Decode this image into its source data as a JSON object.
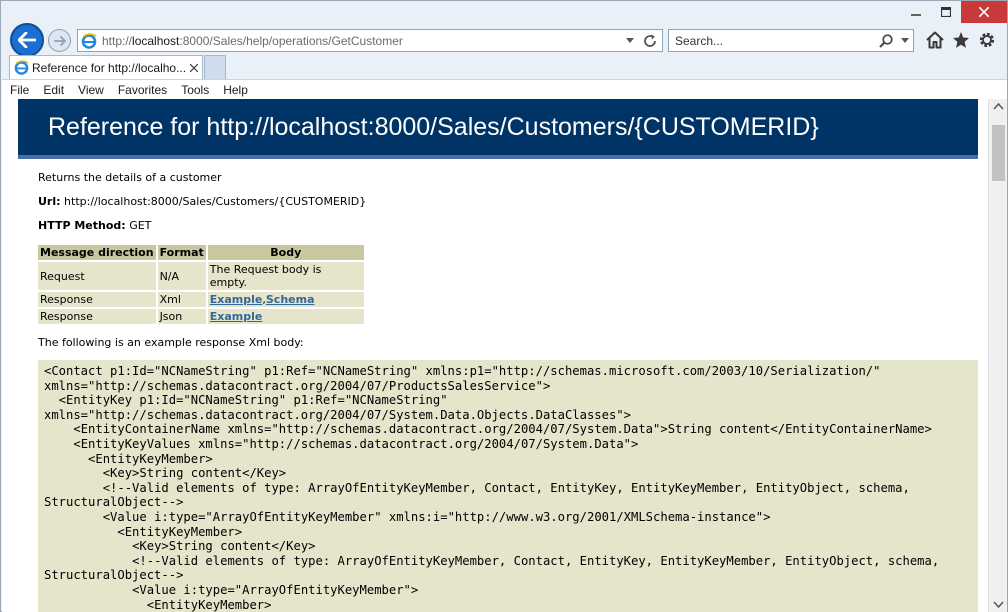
{
  "browser": {
    "address_url_prefix": "http://",
    "address_url_host": "localhost",
    "address_url_rest": ":8000/Sales/help/operations/GetCustomer",
    "search_placeholder": "Search...",
    "tab_label": "Reference for http://localho..."
  },
  "menu": {
    "file": "File",
    "edit": "Edit",
    "view": "View",
    "favorites": "Favorites",
    "tools": "Tools",
    "help": "Help"
  },
  "page": {
    "heading": "Reference for http://localhost:8000/Sales/Customers/{CUSTOMERID}",
    "description": "Returns the details of a customer",
    "url_label": "Url:",
    "url_value": "http://localhost:8000/Sales/Customers/{CUSTOMERID}",
    "method_label": "HTTP Method:",
    "method_value": "GET",
    "table": {
      "headers": [
        "Message direction",
        "Format",
        "Body"
      ],
      "rows": [
        {
          "direction": "Request",
          "format": "N/A",
          "body": "The Request body is empty."
        },
        {
          "direction": "Response",
          "format": "Xml",
          "link1": "Example",
          "sep": ",",
          "link2": "Schema"
        },
        {
          "direction": "Response",
          "format": "Json",
          "link1": "Example"
        }
      ]
    },
    "example_intro": "The following is an example response Xml body:",
    "xml_body": "<Contact p1:Id=\"NCNameString\" p1:Ref=\"NCNameString\" xmlns:p1=\"http://schemas.microsoft.com/2003/10/Serialization/\" xmlns=\"http://schemas.datacontract.org/2004/07/ProductsSalesService\">\n  <EntityKey p1:Id=\"NCNameString\" p1:Ref=\"NCNameString\" xmlns=\"http://schemas.datacontract.org/2004/07/System.Data.Objects.DataClasses\">\n    <EntityContainerName xmlns=\"http://schemas.datacontract.org/2004/07/System.Data\">String content</EntityContainerName>\n    <EntityKeyValues xmlns=\"http://schemas.datacontract.org/2004/07/System.Data\">\n      <EntityKeyMember>\n        <Key>String content</Key>\n        <!--Valid elements of type: ArrayOfEntityKeyMember, Contact, EntityKey, EntityKeyMember, EntityObject, schema, StructuralObject-->\n        <Value i:type=\"ArrayOfEntityKeyMember\" xmlns:i=\"http://www.w3.org/2001/XMLSchema-instance\">\n          <EntityKeyMember>\n            <Key>String content</Key>\n            <!--Valid elements of type: ArrayOfEntityKeyMember, Contact, EntityKey, EntityKeyMember, EntityObject, schema, StructuralObject-->\n            <Value i:type=\"ArrayOfEntityKeyMember\">\n              <EntityKeyMember>"
  },
  "colors": {
    "banner_bg": "#003366",
    "table_header_bg": "#c8c8a0",
    "table_cell_bg": "#e5e5cc",
    "link": "#336699",
    "close_button": "#c7393b",
    "back_button": "#1b6fd1"
  },
  "icons": [
    "minimize-icon",
    "maximize-icon",
    "close-icon",
    "back-arrow-icon",
    "forward-arrow-icon",
    "ie-logo-icon",
    "dropdown-icon",
    "refresh-icon",
    "search-icon",
    "home-icon",
    "favorites-star-icon",
    "settings-gear-icon",
    "tab-close-icon",
    "scroll-up-icon",
    "scroll-down-icon"
  ]
}
